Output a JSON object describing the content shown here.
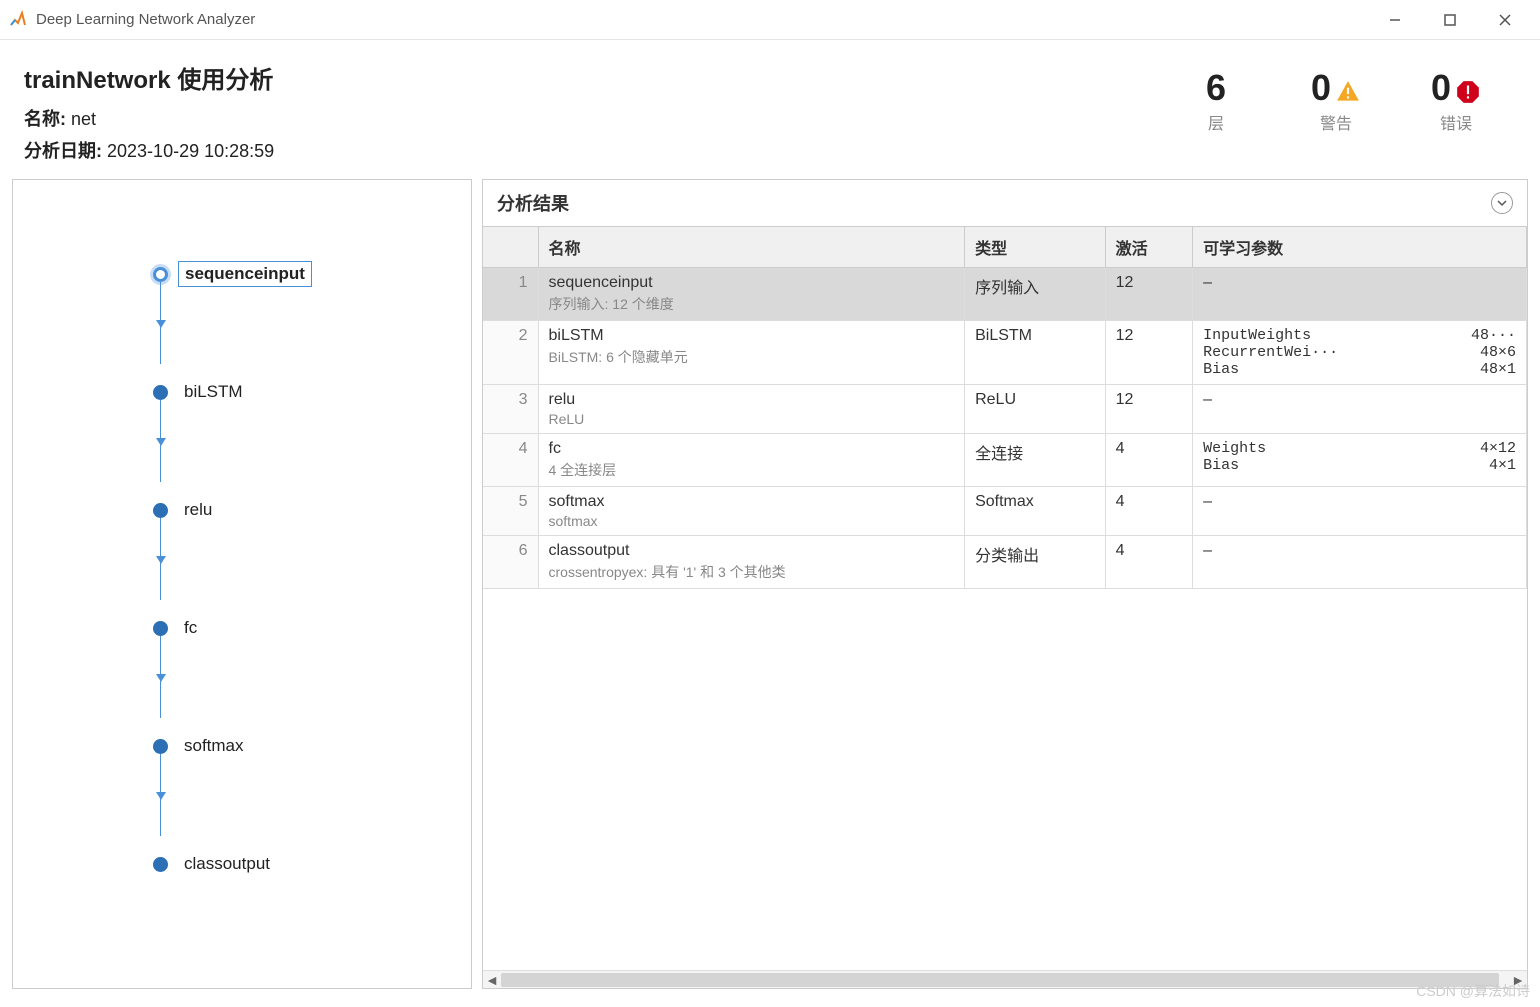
{
  "window": {
    "title": "Deep Learning Network Analyzer"
  },
  "header": {
    "title": "trainNetwork 使用分析",
    "name_label": "名称:",
    "name_value": "net",
    "date_label": "分析日期:",
    "date_value": "2023-10-29 10:28:59"
  },
  "stats": {
    "layers_count": "6",
    "layers_label": "层",
    "warnings_count": "0",
    "warnings_label": "警告",
    "errors_count": "0",
    "errors_label": "错误"
  },
  "graph": {
    "nodes": [
      {
        "label": "sequenceinput",
        "selected": true
      },
      {
        "label": "biLSTM",
        "selected": false
      },
      {
        "label": "relu",
        "selected": false
      },
      {
        "label": "fc",
        "selected": false
      },
      {
        "label": "softmax",
        "selected": false
      },
      {
        "label": "classoutput",
        "selected": false
      }
    ]
  },
  "results": {
    "title": "分析结果",
    "columns": {
      "name": "名称",
      "type": "类型",
      "activations": "激活",
      "learnable": "可学习参数"
    },
    "rows": [
      {
        "idx": "1",
        "name": "sequenceinput",
        "sub": "序列输入: 12 个维度",
        "type": "序列输入",
        "act": "12",
        "params": [],
        "dash": true,
        "selected": true
      },
      {
        "idx": "2",
        "name": "biLSTM",
        "sub": "BiLSTM: 6 个隐藏单元",
        "type": "BiLSTM",
        "act": "12",
        "params": [
          {
            "name": "InputWeights",
            "size": "48···"
          },
          {
            "name": "RecurrentWei···",
            "size": "48×6"
          },
          {
            "name": "Bias",
            "size": "48×1"
          }
        ],
        "dash": false,
        "selected": false
      },
      {
        "idx": "3",
        "name": "relu",
        "sub": "ReLU",
        "type": "ReLU",
        "act": "12",
        "params": [],
        "dash": true,
        "selected": false
      },
      {
        "idx": "4",
        "name": "fc",
        "sub": "4 全连接层",
        "type": "全连接",
        "act": "4",
        "params": [
          {
            "name": "Weights",
            "size": "4×12"
          },
          {
            "name": "Bias",
            "size": "4×1"
          }
        ],
        "dash": false,
        "selected": false
      },
      {
        "idx": "5",
        "name": "softmax",
        "sub": "softmax",
        "type": "Softmax",
        "act": "4",
        "params": [],
        "dash": true,
        "selected": false
      },
      {
        "idx": "6",
        "name": "classoutput",
        "sub": "crossentropyex: 具有 '1' 和 3 个其他类",
        "type": "分类输出",
        "act": "4",
        "params": [],
        "dash": true,
        "selected": false
      }
    ]
  },
  "watermark": "CSDN @算法如诗"
}
